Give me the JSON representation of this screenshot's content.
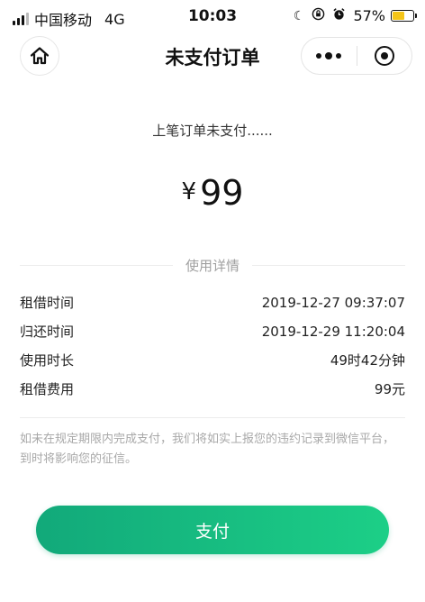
{
  "status_bar": {
    "carrier": "中国移动",
    "network": "4G",
    "time": "10:03",
    "battery_percent": "57%",
    "battery_level": 0.57,
    "icons": [
      "signal-icon",
      "moon-icon",
      "lock-rotation-icon",
      "alarm-icon",
      "battery-icon"
    ]
  },
  "nav": {
    "title": "未支付订单",
    "home_icon": "home-icon",
    "more_icon": "more-dots-icon",
    "close_icon": "close-target-icon"
  },
  "order": {
    "hint": "上笔订单未支付......",
    "currency": "¥",
    "amount": "99"
  },
  "details": {
    "section_title": "使用详情",
    "rows": [
      {
        "label": "租借时间",
        "value": "2019-12-27 09:37:07"
      },
      {
        "label": "归还时间",
        "value": "2019-12-29 11:20:04"
      },
      {
        "label": "使用时长",
        "value": "49时42分钟"
      },
      {
        "label": "租借费用",
        "value": "99元"
      }
    ]
  },
  "notice": "如未在规定期限内完成支付，我们将如实上报您的违约记录到微信平台，到时将影响您的征信。",
  "pay_button": {
    "label": "支付",
    "gradient_start": "#12a97a",
    "gradient_end": "#1ccf87"
  }
}
